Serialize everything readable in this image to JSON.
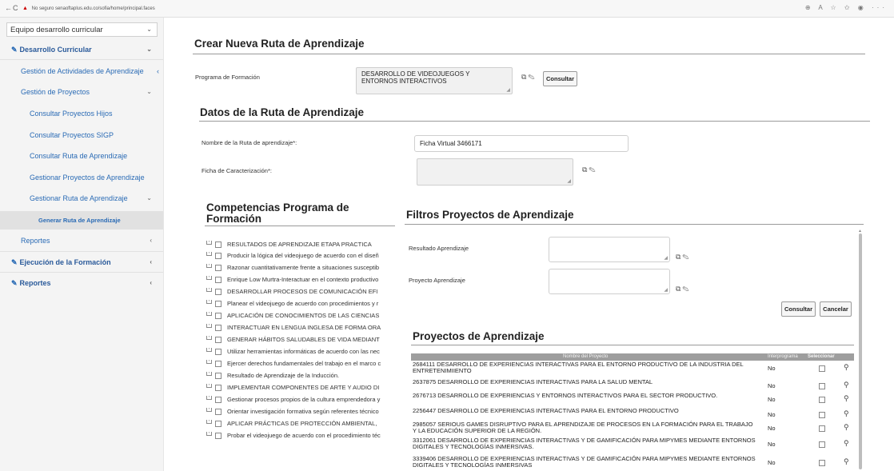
{
  "browser": {
    "back": "←",
    "reload": "C",
    "warning": "▲",
    "url": "No seguro  senaoftaplus.edu.co/sofia/home/principal.faces",
    "tools": "⊕ A ☆ ✩ ◉ ···"
  },
  "sidebar": {
    "select_value": "Equipo desarrollo curricular",
    "select_chev": "⌄",
    "items": [
      {
        "label": "Desarrollo Curricular",
        "arrow": "⌄"
      },
      {
        "label": "Gestión de Actividades de Aprendizaje",
        "arrow": "‹"
      },
      {
        "label": "Gestión de Proyectos",
        "arrow": "⌄"
      },
      {
        "label": "Consultar Proyectos Hijos"
      },
      {
        "label": "Consultar Proyectos SIGP"
      },
      {
        "label": "Consultar Ruta de Aprendizaje"
      },
      {
        "label": "Gestionar Proyectos de Aprendizaje"
      },
      {
        "label": "Gestionar Ruta de Aprendizaje",
        "arrow": "⌄"
      },
      {
        "label": "Generar Ruta de Aprendizaje"
      },
      {
        "label": "Reportes",
        "arrow": "‹"
      },
      {
        "label": "Ejecución de la Formación",
        "arrow": "‹"
      },
      {
        "label": "Reportes",
        "arrow": "‹"
      }
    ],
    "edit_icon": "✎"
  },
  "crear": {
    "title": "Crear Nueva Ruta de Aprendizaje",
    "programa_label": "Programa de Formación",
    "programa_value": "DESARROLLO DE VIDEOJUEGOS Y ENTORNOS INTERACTIVOS",
    "consultar": "Consultar"
  },
  "datos": {
    "title": "Datos de la Ruta de Aprendizaje",
    "nombre_label": "Nombre de la Ruta de aprendizaje*:",
    "nombre_value": "Ficha Virtual 3466171",
    "ficha_label": "Ficha de Caracterización*:"
  },
  "competencias": {
    "title": "Competencias Programa de Formación",
    "items": [
      "RESULTADOS DE APRENDIZAJE ETAPA PRACTICA",
      "Producir la lógica del videojuego de acuerdo con el diseñ",
      "Razonar cuantitativamente frente a situaciones susceptib",
      "Enrique Low Murtra-Interactuar en el contexto productivo",
      "DESARROLLAR PROCESOS DE COMUNICACIÓN EFI",
      "Planear el videojuego de acuerdo con procedimientos y r",
      "APLICACIÓN DE CONOCIMIENTOS DE LAS CIENCIAS",
      "INTERACTUAR EN LENGUA INGLESA DE FORMA ORA",
      "GENERAR HÁBITOS SALUDABLES DE VIDA MEDIANT",
      "Utilizar herramientas informáticas de acuerdo con las nec",
      "Ejercer derechos fundamentales del trabajo en el marco c",
      "Resultado de Aprendizaje de la Inducción.",
      "IMPLEMENTAR COMPONENTES DE ARTE Y AUDIO DI",
      "Gestionar procesos propios de la cultura emprendedora y",
      "Orientar investigación formativa según referentes técnico",
      "APLICAR PRÁCTICAS DE PROTECCIÓN AMBIENTAL,",
      "Probar el videojuego de acuerdo con el procedimiento téc"
    ]
  },
  "filtros": {
    "title": "Filtros Proyectos de Aprendizaje",
    "resultado_label": "Resultado Aprendizaje",
    "proyecto_label": "Proyecto Aprendizaje",
    "consultar": "Consultar",
    "cancelar": "Cancelar"
  },
  "proyectos": {
    "title": "Proyectos de Aprendizaje",
    "headers": [
      "Nombre del Proyecto",
      "Interprograma",
      "Seleccionar"
    ],
    "rows": [
      {
        "name": "2684111 DESARROLLO DE EXPERIENCIAS INTERACTIVAS PARA EL ENTORNO PRODUCTIVO DE LA INDUSTRIA DEL ENTRETENIMIIENTO",
        "inter": "No"
      },
      {
        "name": "2637875 DESARROLLO DE EXPERIENCIAS INTERACTIVAS PARA LA SALUD MENTAL",
        "inter": "No"
      },
      {
        "name": "2676713 DESARROLLO DE EXPERIENCIAS Y ENTORNOS INTERACTIVOS PARA EL SECTOR PRODUCTIVO.",
        "inter": "No"
      },
      {
        "name": "2256447 DESARROLLO DE EXPERIENCIAS INTERACTIVAS PARA EL ENTORNO PRODUCTIVO",
        "inter": "No"
      },
      {
        "name": "2985057 SERIOUS GAMES DISRUPTIVO PARA EL APRENDIZAJE DE PROCESOS EN LA FORMACIÓN PARA EL TRABAJO Y LA EDUCACIÓN SUPERIOR DE LA REGIÓN.",
        "inter": "No"
      },
      {
        "name": "3312061 DESARROLLO DE EXPERIENCIAS INTERACTIVAS Y DE GAMIFICACIÓN PARA MIPYMES MEDIANTE ENTORNOS DIGITALES Y TECNOLOGÍAS INMERSIVAS.",
        "inter": "No"
      },
      {
        "name": "3339406 DESARROLLO DE EXPERIENCIAS INTERACTIVAS Y DE GAMIFICACIÓN PARA MIPYMES MEDIANTE ENTORNOS DIGITALES Y TECNOLOGÍAS INMERSIVAS",
        "inter": "No"
      }
    ]
  },
  "icons": {
    "search_lookup": "⧉",
    "clear": "🧹",
    "magnifier": "⚲"
  }
}
